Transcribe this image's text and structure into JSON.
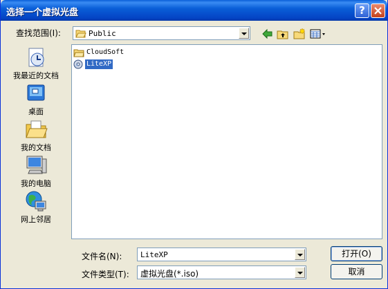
{
  "window": {
    "title": "选择一个虚拟光盘",
    "help_glyph": "?"
  },
  "lookin": {
    "label": "查找范围(I):",
    "value": "Public",
    "folder_icon": "folder-open-icon"
  },
  "toolbar": [
    "back-arrow-icon",
    "up-folder-icon",
    "new-folder-icon",
    "view-menu-icon"
  ],
  "places": [
    {
      "label": "我最近的文档",
      "icon": "recent-documents-icon"
    },
    {
      "label": "桌面",
      "icon": "desktop-icon"
    },
    {
      "label": "我的文档",
      "icon": "my-documents-icon"
    },
    {
      "label": "我的电脑",
      "icon": "my-computer-icon"
    },
    {
      "label": "网上邻居",
      "icon": "network-places-icon"
    }
  ],
  "files": [
    {
      "name": "CloudSoft",
      "icon": "folder-icon",
      "selected": false
    },
    {
      "name": "LiteXP",
      "icon": "disc-image-icon",
      "selected": true
    }
  ],
  "filename": {
    "label": "文件名(N):",
    "value": "LiteXP"
  },
  "filetype": {
    "label": "文件类型(T):",
    "value": "虚拟光盘(*.iso)"
  },
  "buttons": {
    "open": "打开(O)",
    "cancel": "取消"
  },
  "colors": {
    "title_bar": "#0a5fd8",
    "dialog_bg": "#ece9d8",
    "selection": "#316ac5"
  }
}
